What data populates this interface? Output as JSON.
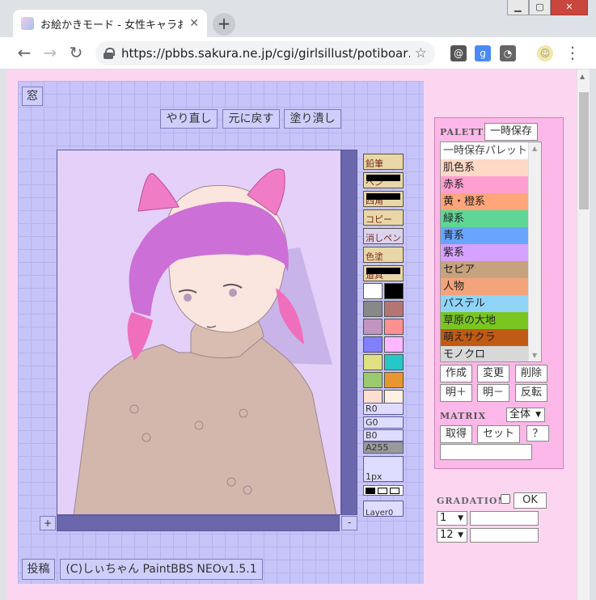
{
  "browser": {
    "tab_title": "お絵かきモード - 女性キャラお絵かき掲示板",
    "url": "https://pbbs.sakura.ne.jp/cgi/girlsillust/potiboar…",
    "new_tab": "+",
    "close_tab": "✕"
  },
  "board": {
    "window_button": "窓",
    "redo": "やり直し",
    "undo": "元に戻す",
    "fill": "塗り潰し",
    "zoom_in": "+",
    "zoom_out": "-",
    "post": "投稿",
    "credit": "(C)しぃちゃん PaintBBS NEOv1.5.1"
  },
  "tools": [
    "鉛筆",
    "ペン",
    "四角",
    "コピー",
    "消しペン",
    "色塗",
    "道具"
  ],
  "swatches": [
    [
      "#ffffff",
      "#000000"
    ],
    [
      "#888888",
      "#b47575"
    ],
    [
      "#c095c0",
      "#ff9090"
    ],
    [
      "#8080ff",
      "#ffb8ff"
    ],
    [
      "#e0e080",
      "#25c7c9"
    ],
    [
      "#9bca6e",
      "#e8962f"
    ],
    [
      "#ffdfd0",
      "#fff0e4"
    ]
  ],
  "color_values": {
    "r": "R0",
    "g": "G0",
    "b": "B0",
    "a": "A255"
  },
  "brush_size": "1px",
  "layer": "Layer0",
  "palette": {
    "header": "PALETTE",
    "temp_save": "一時保存",
    "items": [
      {
        "label": "一時保存パレット",
        "color": "#ffffff"
      },
      {
        "label": "肌色系",
        "color": "#ffd8c6"
      },
      {
        "label": "赤系",
        "color": "#ff9fd2"
      },
      {
        "label": "黄・橙系",
        "color": "#ffa57a"
      },
      {
        "label": "緑系",
        "color": "#5ed796"
      },
      {
        "label": "青系",
        "color": "#69a5ff"
      },
      {
        "label": "紫系",
        "color": "#d6a2ff"
      },
      {
        "label": "セピア",
        "color": "#c7a27e"
      },
      {
        "label": "人物",
        "color": "#f4a47a"
      },
      {
        "label": "パステル",
        "color": "#8fd4f7"
      },
      {
        "label": "草原の大地",
        "color": "#7ac520"
      },
      {
        "label": "萌えサクラ",
        "color": "#c15a14"
      },
      {
        "label": "モノクロ",
        "color": "#d8d8d8"
      }
    ],
    "create": "作成",
    "change": "変更",
    "delete": "削除",
    "bright_plus": "明＋",
    "bright_minus": "明－",
    "invert": "反転"
  },
  "matrix": {
    "header": "MATRIX",
    "scope": "全体",
    "get": "取得",
    "set": "セット",
    "help": "？"
  },
  "gradation": {
    "header": "GRADATION",
    "ok": "OK",
    "sel1": "1",
    "sel2": "12"
  }
}
